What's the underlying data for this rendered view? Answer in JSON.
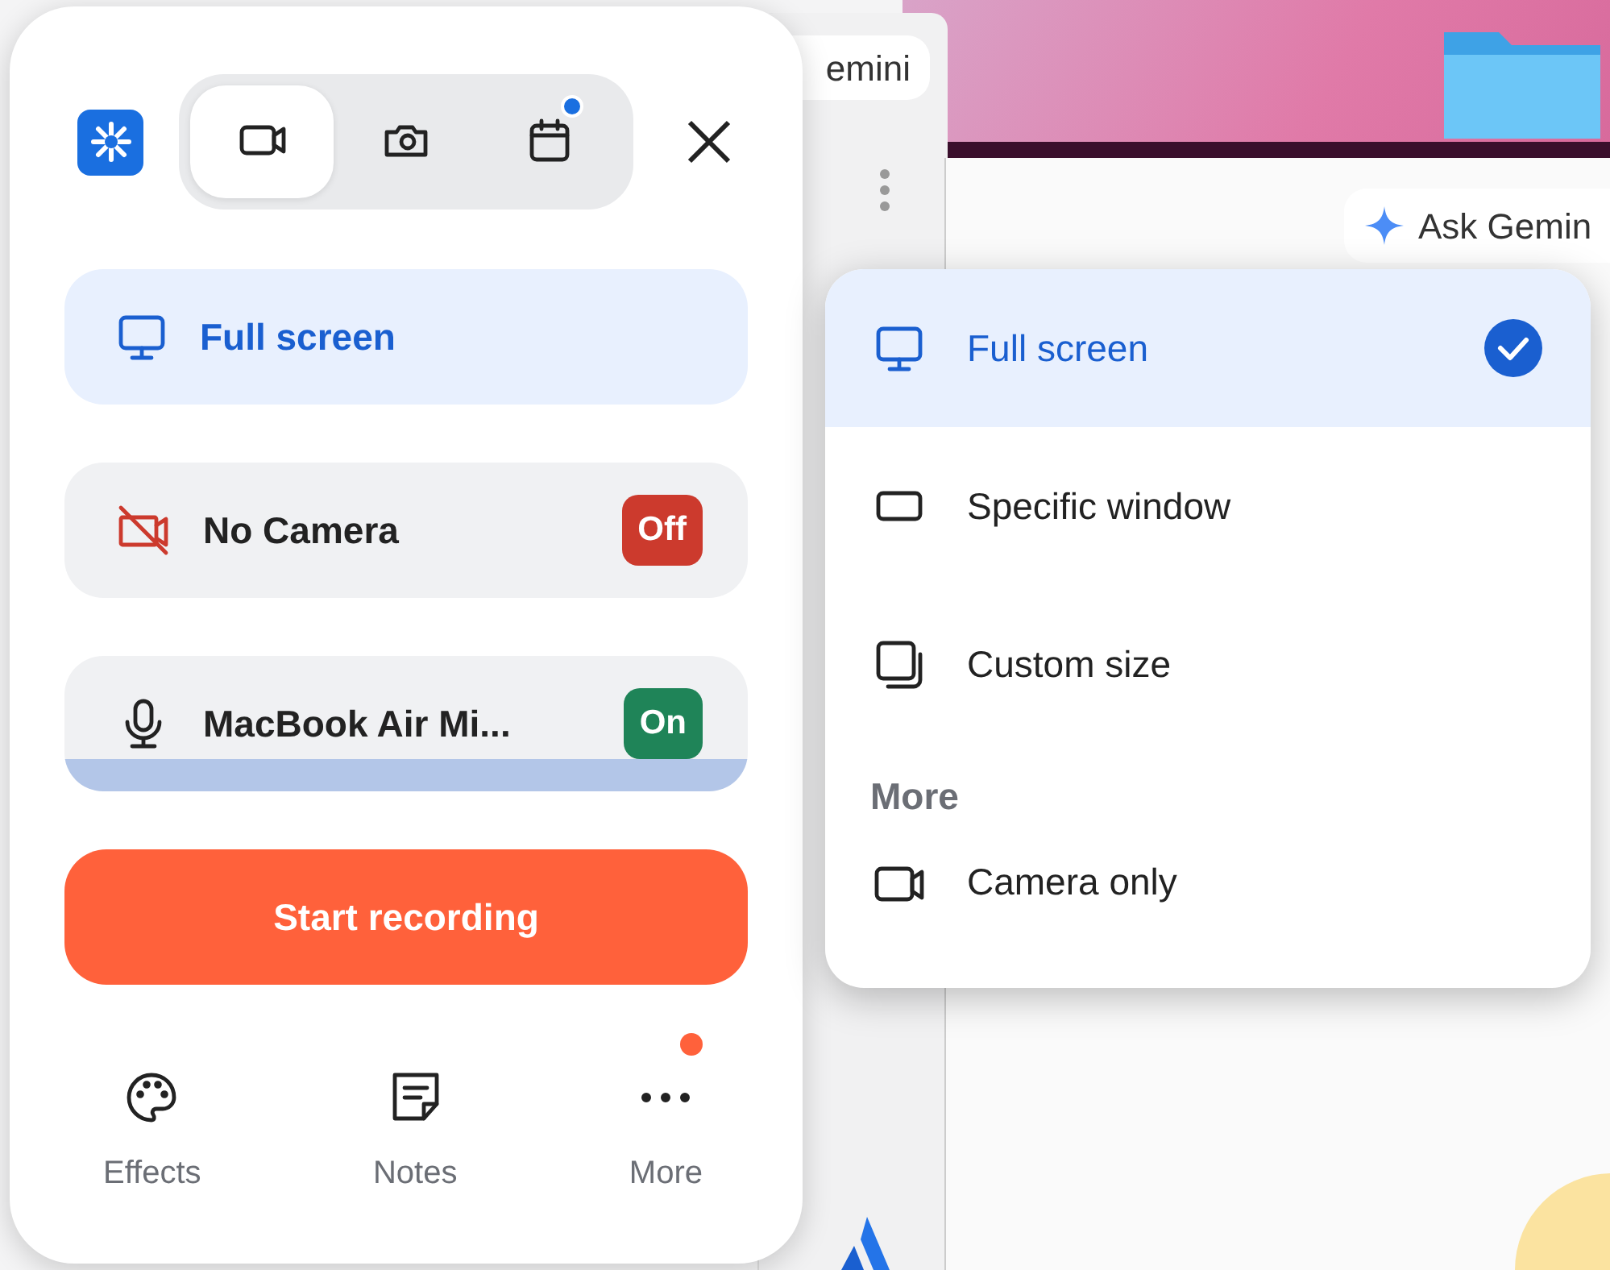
{
  "background": {
    "chips": [
      {
        "label": "emini"
      },
      {
        "label": "Ask Gemin"
      }
    ]
  },
  "recorder": {
    "mode_tabs": [
      {
        "kind": "video",
        "selected": true,
        "badge": false
      },
      {
        "kind": "photo",
        "selected": false,
        "badge": false
      },
      {
        "kind": "calendar",
        "selected": false,
        "badge": true
      }
    ],
    "source": {
      "label": "Full screen"
    },
    "camera": {
      "label": "No Camera",
      "status": "Off",
      "on": false
    },
    "microphone": {
      "label": "MacBook Air Mi...",
      "status": "On",
      "on": true
    },
    "start_button": "Start recording",
    "footer": [
      {
        "kind": "effects",
        "label": "Effects",
        "badge": false
      },
      {
        "kind": "notes",
        "label": "Notes",
        "badge": false
      },
      {
        "kind": "more",
        "label": "More",
        "badge": true
      }
    ]
  },
  "menu": {
    "items": [
      {
        "kind": "monitor",
        "label": "Full screen",
        "selected": true
      },
      {
        "kind": "window",
        "label": "Specific window",
        "selected": false
      },
      {
        "kind": "custom",
        "label": "Custom size",
        "selected": false
      }
    ],
    "section": "More",
    "extra": [
      {
        "kind": "camera",
        "label": "Camera only",
        "selected": false
      }
    ]
  }
}
